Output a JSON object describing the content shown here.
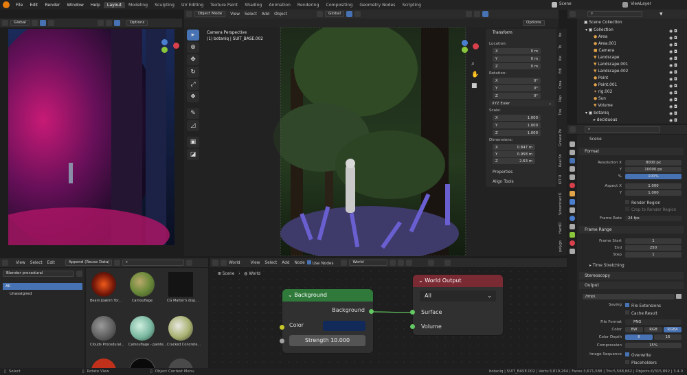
{
  "menu": [
    "File",
    "Edit",
    "Render",
    "Window",
    "Help"
  ],
  "workspaces": [
    "Layout",
    "Modeling",
    "Sculpting",
    "UV Editing",
    "Texture Paint",
    "Shading",
    "Animation",
    "Rendering",
    "Compositing",
    "Geometry Nodes",
    "Scripting"
  ],
  "active_workspace": "Layout",
  "scene_name": "Scene",
  "view_layer": "ViewLayer",
  "left_viewport": {
    "transform_orientation": "Global",
    "options": "Options"
  },
  "main_viewport": {
    "mode": "Object Mode",
    "menus": [
      "View",
      "Select",
      "Add",
      "Object"
    ],
    "transform_orientation": "Global",
    "options": "Options",
    "camera_label": "Camera Perspective",
    "object_label": "(1) botaniq | SUIT_BASE.002"
  },
  "npanel": {
    "title": "Transform",
    "location_label": "Location:",
    "location": [
      {
        "axis": "X",
        "value": "0 m"
      },
      {
        "axis": "Y",
        "value": "0 m"
      },
      {
        "axis": "Z",
        "value": "0 m"
      }
    ],
    "rotation_label": "Rotation:",
    "rotation": [
      {
        "axis": "X",
        "value": "0°"
      },
      {
        "axis": "Y",
        "value": "0°"
      },
      {
        "axis": "Z",
        "value": "0°"
      }
    ],
    "rotation_mode": "XYZ Euler",
    "scale_label": "Scale:",
    "scale": [
      {
        "axis": "X",
        "value": "1.000"
      },
      {
        "axis": "Y",
        "value": "1.000"
      },
      {
        "axis": "Z",
        "value": "1.000"
      }
    ],
    "dimensions_label": "Dimensions:",
    "dimensions": [
      {
        "axis": "X",
        "value": "0.847 m"
      },
      {
        "axis": "Y",
        "value": "0.958 m"
      },
      {
        "axis": "Z",
        "value": "2.63 m"
      }
    ],
    "properties": "Properties",
    "align_tools": "Align Tools",
    "side_tabs": [
      "Ite",
      "To",
      "Vie",
      "Edi",
      "Crea",
      "Pap",
      "Tiss",
      "Grease Pe",
      "Real Sn",
      "KIT O",
      "Screencast K",
      "HardO",
      "polygo"
    ]
  },
  "outliner": {
    "root": "Scene Collection",
    "collection": "Collection",
    "items": [
      "Area",
      "Area.001",
      "Camera",
      "Landscape",
      "Landscape.001",
      "Landscape.002",
      "Point",
      "Point.001",
      "rig.002",
      "Sun",
      "Volume"
    ],
    "botaniq": "botaniq",
    "last": "deciduous"
  },
  "properties": {
    "scene": "Scene",
    "format": "Format",
    "resolution_x_label": "Resolution X",
    "resolution_x": "8000 px",
    "y_label": "Y",
    "resolution_y": "10000 px",
    "percent_label": "%",
    "percent": "100%",
    "aspect_x_label": "Aspect X",
    "aspect_x": "1.000",
    "aspect_y": "1.000",
    "render_region": "Render Region",
    "crop": "Crop to Render Region",
    "frame_rate_label": "Frame Rate",
    "frame_rate": "24 fps",
    "frame_range": "Frame Range",
    "frame_start_label": "Frame Start",
    "frame_start": "1",
    "end_label": "End",
    "end": "250",
    "step_label": "Step",
    "step": "1",
    "time_stretching": "Time Stretching",
    "stereoscopy": "Stereoscopy",
    "output": "Output",
    "path": "/tmp\\",
    "saving_label": "Saving",
    "file_extensions": "File Extensions",
    "cache_result": "Cache Result",
    "file_format_label": "File Format",
    "file_format": "PNG",
    "color_label": "Color",
    "color_options": [
      "BW",
      "RGB",
      "RGBA"
    ],
    "color_depth_label": "Color Depth",
    "color_depth": [
      "8",
      "16"
    ],
    "compression_label": "Compression",
    "compression": "15%",
    "image_sequence_label": "Image Sequence",
    "overwrite": "Overwrite",
    "placeholders": "Placeholders"
  },
  "asset_browser": {
    "menus": [
      "View",
      "Select",
      "Edit"
    ],
    "import_mode": "Append (Reuse Data)",
    "library": "Blender procedural",
    "catalogs": [
      "All",
      "Unassigned"
    ],
    "assets": [
      "Beam Joakim Tor...",
      "Camouflage",
      "CG Matter's disp...",
      "Clouds Procedural...",
      "Camouflage - painte...",
      "Cracked Concrete..."
    ]
  },
  "node_editor": {
    "type": "World",
    "menus": [
      "View",
      "Select",
      "Add",
      "Node"
    ],
    "use_nodes": "Use Nodes",
    "datablock": "World",
    "breadcrumb": [
      "Scene",
      "World"
    ],
    "background_node": {
      "title": "Background",
      "output": "Background",
      "color_label": "Color",
      "strength_label": "Strength",
      "strength": "10.000"
    },
    "output_node": {
      "title": "World Output",
      "target": "All",
      "surface": "Surface",
      "volume": "Volume"
    }
  },
  "status_bar": {
    "left": [
      "Select",
      "Rotate View",
      "Object Context Menu"
    ],
    "right": "botaniq | SUIT_BASE.002 | Verts:3,819,264 | Faces:3,671,588 | Tris:5,568,862 | Objects:0/315,892 | 3.4.0"
  },
  "colors": {
    "accent": "#4772b3",
    "bg_node_header": "#2f7a3a",
    "output_node_header": "#7a2a33",
    "socket_green": "#63c763",
    "socket_yellow": "#c7c729"
  }
}
